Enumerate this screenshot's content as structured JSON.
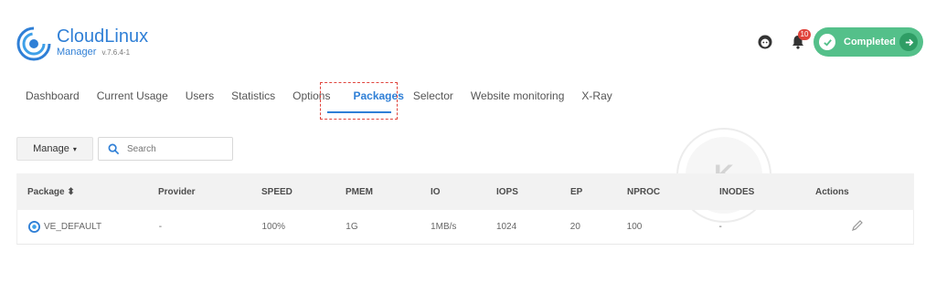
{
  "header": {
    "brand": "CloudLinux",
    "product": "Manager",
    "version": "v.7.6.4-1",
    "notification_count": "10",
    "status_button": "Completed"
  },
  "nav": {
    "tabs": [
      {
        "label": "Dashboard"
      },
      {
        "label": "Current Usage"
      },
      {
        "label": "Users"
      },
      {
        "label": "Statistics"
      },
      {
        "label": "Options"
      },
      {
        "label": "Packages",
        "active": true
      },
      {
        "label": "Selector"
      },
      {
        "label": "Website monitoring"
      },
      {
        "label": "X-Ray"
      }
    ]
  },
  "toolbar": {
    "manage_label": "Manage",
    "search_placeholder": "Search"
  },
  "table": {
    "columns": [
      "Package",
      "Provider",
      "SPEED",
      "PMEM",
      "IO",
      "IOPS",
      "EP",
      "NPROC",
      "INODES",
      "Actions"
    ],
    "rows": [
      {
        "package": "VE_DEFAULT",
        "provider": "-",
        "speed": "100%",
        "pmem": "1G",
        "io": "1MB/s",
        "iops": "1024",
        "ep": "20",
        "nproc": "100",
        "inodes": "-"
      }
    ]
  },
  "colors": {
    "accent": "#2f7fd6",
    "completed": "#54c08a",
    "highlight_box": "#e0443c"
  },
  "icons": [
    "cloudlinux-logo-icon",
    "support-agent-icon",
    "bell-icon",
    "check-icon",
    "arrow-right-icon",
    "search-icon",
    "package-icon",
    "pencil-icon"
  ]
}
